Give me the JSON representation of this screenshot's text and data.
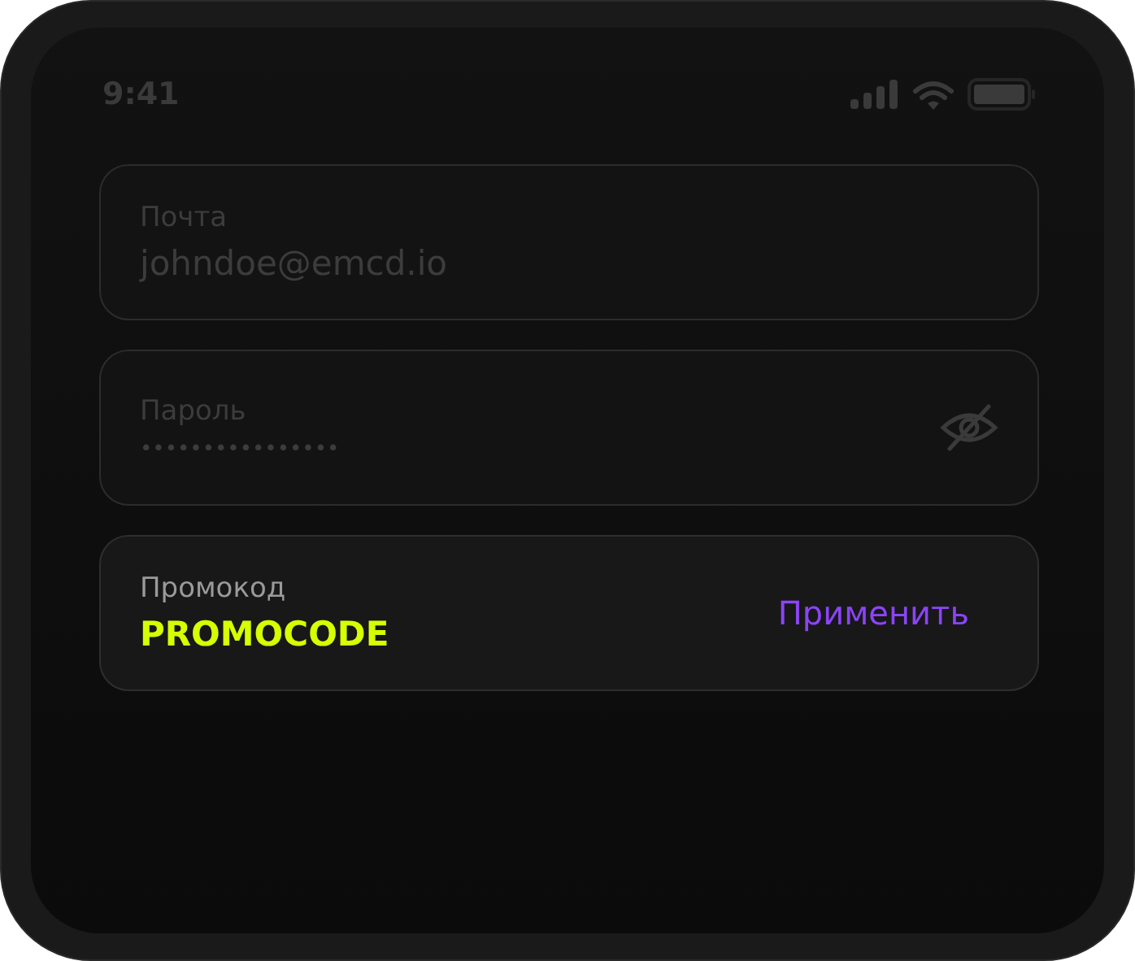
{
  "status_bar": {
    "time": "9:41"
  },
  "fields": [
    {
      "kind": "text",
      "label": "Почта",
      "value": "johndoe@emcd.io",
      "disabled": true
    },
    {
      "kind": "password",
      "label": "Пароль",
      "value": "••••••••••••••••",
      "disabled": true
    },
    {
      "kind": "promo",
      "label": "Промокод",
      "value": "PROMOCODE",
      "action": "Применить",
      "disabled": false
    }
  ]
}
